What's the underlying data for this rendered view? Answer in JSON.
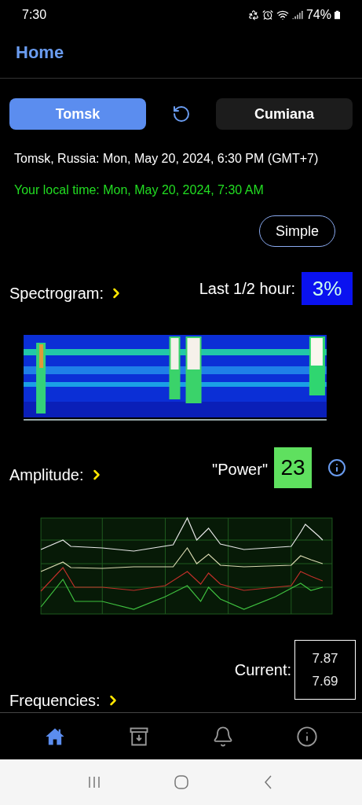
{
  "status_bar": {
    "time": "7:30",
    "battery": "74%"
  },
  "header": {
    "title": "Home"
  },
  "cities": [
    {
      "label": "Tomsk",
      "selected": true
    },
    {
      "label": "Cumiana",
      "selected": false
    }
  ],
  "station_time": "Tomsk, Russia: Mon, May 20, 2024, 6:30 PM (GMT+7)",
  "local_time": "Your local time: Mon, May 20, 2024, 7:30 AM",
  "mode_button": "Simple",
  "spectrogram": {
    "label": "Spectrogram:",
    "last_label": "Last 1/2 hour:",
    "last_value": "3%",
    "kind": "picture"
  },
  "amplitude": {
    "label": "Amplitude:",
    "power_label": "\"Power\"",
    "power_value": "23",
    "kind": "picture"
  },
  "current": {
    "label": "Current:",
    "values": [
      "7.87",
      "7.69"
    ]
  },
  "frequencies": {
    "label": "Frequencies:"
  },
  "nav": [
    {
      "kind": "home",
      "selected": true
    },
    {
      "kind": "archive",
      "selected": false
    },
    {
      "kind": "bell",
      "selected": false
    },
    {
      "kind": "info",
      "selected": false
    }
  ]
}
